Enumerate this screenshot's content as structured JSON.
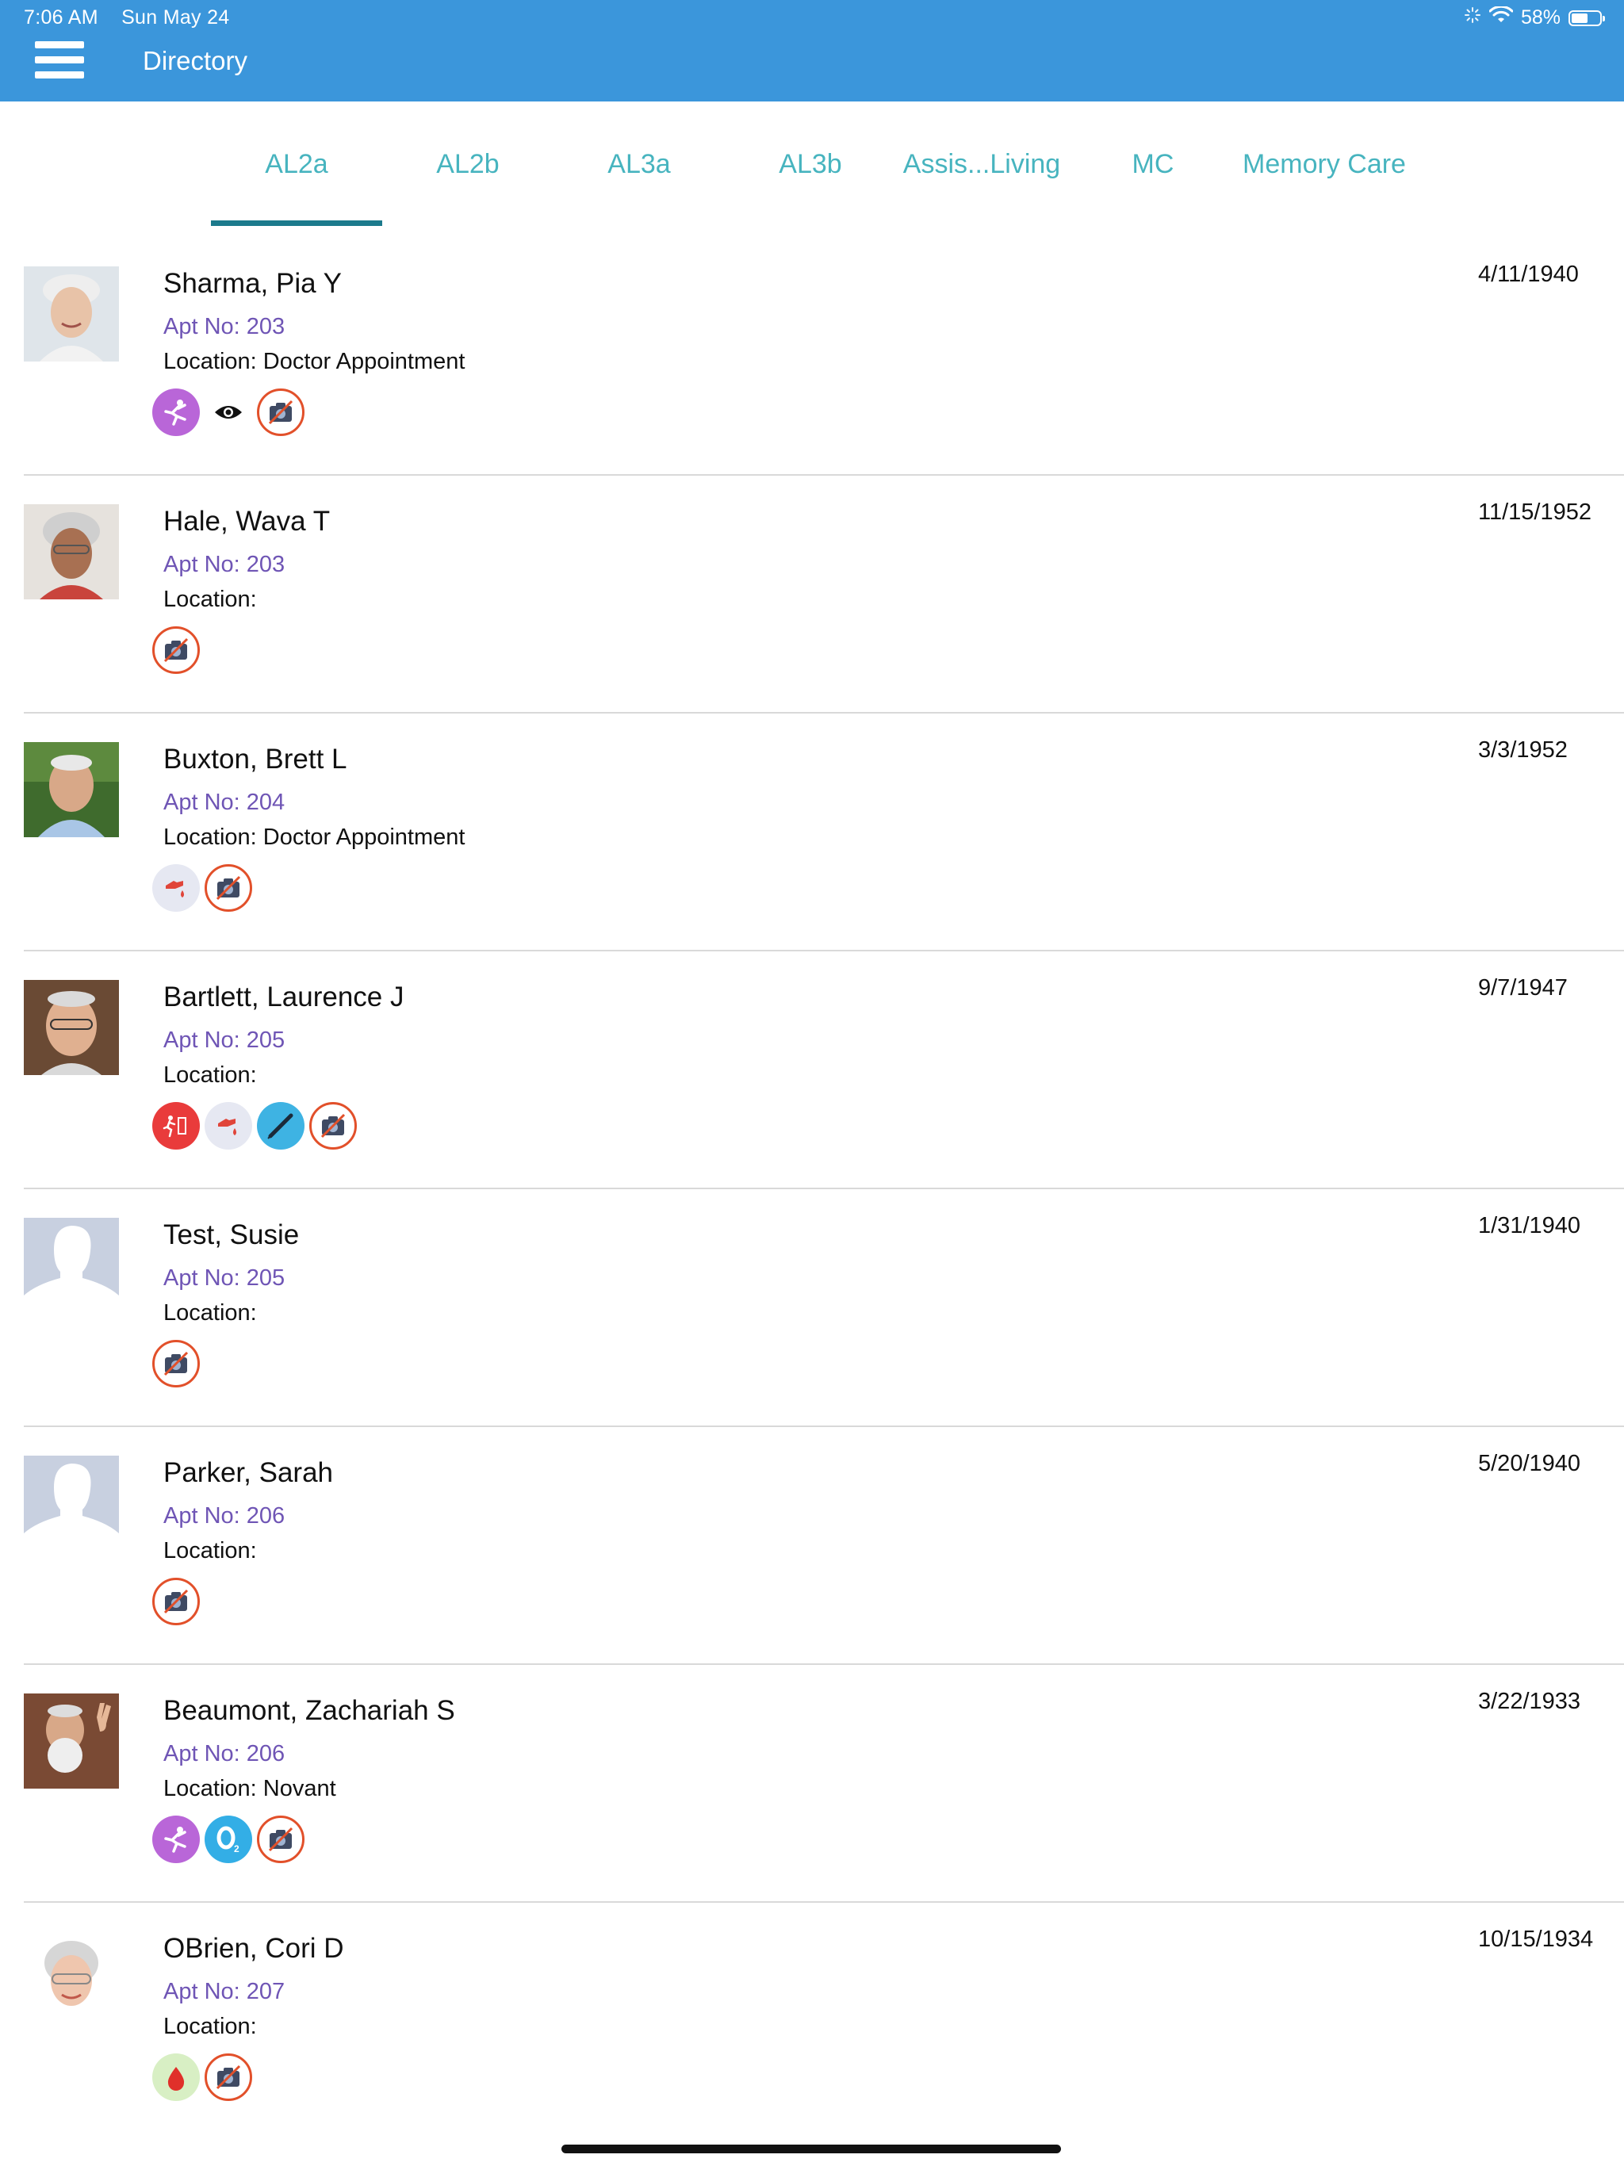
{
  "status_bar": {
    "time": "7:06 AM",
    "date": "Sun May 24",
    "battery": "58%",
    "battery_level": 0.58
  },
  "header": {
    "title": "Directory",
    "menu_icon": "hamburger-menu-icon",
    "background": "#3b96db"
  },
  "tabs": {
    "items": [
      "AL2a",
      "AL2b",
      "AL3a",
      "AL3b",
      "Assis...Living",
      "MC",
      "Memory Care"
    ],
    "selected": "AL2a",
    "color": "#47b4bf",
    "indicator_color": "#1c7a8c"
  },
  "residents": [
    {
      "name": "Sharma, Pia Y",
      "apt": "Apt No: 203",
      "location": "Location: Doctor Appointment",
      "dob": "4/11/1940",
      "photo": "photo-elderly-woman-smiling",
      "icons": [
        "fall-risk-icon",
        "vision-icon",
        "no-photo-icon"
      ]
    },
    {
      "name": "Hale, Wava T",
      "apt": "Apt No: 203",
      "location": "Location:",
      "dob": "11/15/1952",
      "photo": "photo-elderly-woman-glasses",
      "icons": [
        "no-photo-icon"
      ]
    },
    {
      "name": "Buxton, Brett L",
      "apt": "Apt No: 204",
      "location": "Location: Doctor Appointment",
      "dob": "3/3/1952",
      "photo": "photo-elderly-man",
      "icons": [
        "blood-sugar-icon",
        "no-photo-icon"
      ]
    },
    {
      "name": "Bartlett, Laurence J",
      "apt": "Apt No: 205",
      "location": "Location:",
      "dob": "9/7/1947",
      "photo": "photo-elderly-man-glasses",
      "icons": [
        "elopement-risk-icon",
        "blood-sugar-icon",
        "injection-icon",
        "no-photo-icon"
      ]
    },
    {
      "name": "Test, Susie",
      "apt": "Apt No: 205",
      "location": "Location:",
      "dob": "1/31/1940",
      "photo": "placeholder-avatar",
      "icons": [
        "no-photo-icon"
      ]
    },
    {
      "name": "Parker, Sarah",
      "apt": "Apt No: 206",
      "location": "Location:",
      "dob": "5/20/1940",
      "photo": "placeholder-avatar",
      "icons": [
        "no-photo-icon"
      ]
    },
    {
      "name": "Beaumont, Zachariah S",
      "apt": "Apt No: 206",
      "location": "Location: Novant",
      "dob": "3/22/1933",
      "photo": "photo-elderly-man-beard",
      "icons": [
        "fall-risk-icon",
        "oxygen-icon",
        "no-photo-icon"
      ]
    },
    {
      "name": "OBrien, Cori D",
      "apt": "Apt No: 207",
      "location": "Location:",
      "dob": "10/15/1934",
      "photo": "photo-elderly-woman-glasses-light",
      "icons": [
        "blood-drop-icon",
        "no-photo-icon"
      ]
    }
  ]
}
